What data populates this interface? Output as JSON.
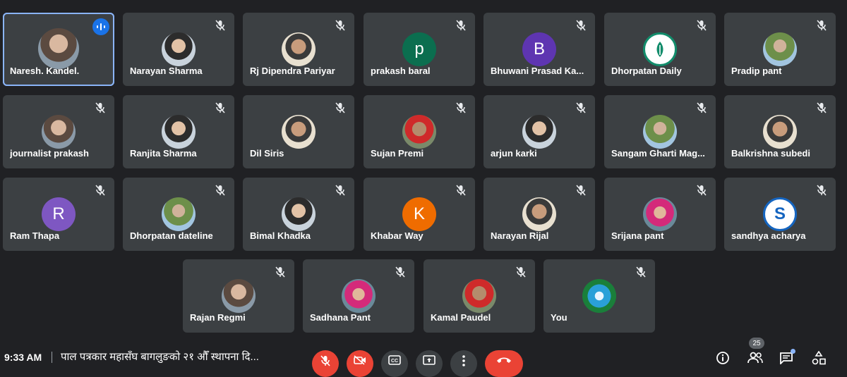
{
  "participants": [
    {
      "name": "Naresh. Kandel.",
      "avatar": "photo",
      "speaking": true
    },
    {
      "name": "Narayan Sharma",
      "avatar": "photo"
    },
    {
      "name": "Rj Dipendra Pariyar",
      "avatar": "photo"
    },
    {
      "name": "prakash baral",
      "avatar": "letter",
      "letter": "p",
      "color": "#0b6e4f"
    },
    {
      "name": "Bhuwani Prasad Ka...",
      "avatar": "letter",
      "letter": "B",
      "color": "#5e35b1"
    },
    {
      "name": "Dhorpatan Daily",
      "avatar": "logo"
    },
    {
      "name": "Pradip pant",
      "avatar": "photo"
    },
    {
      "name": "journalist prakash",
      "avatar": "photo"
    },
    {
      "name": "Ranjita Sharma",
      "avatar": "photo"
    },
    {
      "name": "Dil Siris",
      "avatar": "photo"
    },
    {
      "name": "Sujan Premi",
      "avatar": "photo"
    },
    {
      "name": "arjun karki",
      "avatar": "photo"
    },
    {
      "name": "Sangam Gharti Mag...",
      "avatar": "photo"
    },
    {
      "name": "Balkrishna subedi",
      "avatar": "photo"
    },
    {
      "name": "Ram Thapa",
      "avatar": "letter",
      "letter": "R",
      "color": "#7e57c2"
    },
    {
      "name": "Dhorpatan dateline",
      "avatar": "photo"
    },
    {
      "name": "Bimal Khadka",
      "avatar": "photo"
    },
    {
      "name": "Khabar Way",
      "avatar": "letter",
      "letter": "K",
      "color": "#ef6c00"
    },
    {
      "name": "Narayan Rijal",
      "avatar": "photo"
    },
    {
      "name": "Srijana pant",
      "avatar": "photo"
    },
    {
      "name": "sandhya acharya",
      "avatar": "letter-ring",
      "letter": "S",
      "color": "#1565c0"
    },
    {
      "name": "Rajan Regmi",
      "avatar": "photo"
    },
    {
      "name": "Sadhana Pant",
      "avatar": "photo"
    },
    {
      "name": "Kamal Paudel",
      "avatar": "photo"
    },
    {
      "name": "You",
      "avatar": "globe"
    }
  ],
  "bottom_bar": {
    "time": "9:33 AM",
    "meeting_title": "पाल पत्रकार महासँघ बागलुङको २१ औँ स्थापना दि...",
    "participant_count": "25"
  },
  "colors": {
    "background": "#202124",
    "tile": "#3c4043",
    "active_outline": "#8ab4f8",
    "hangup": "#ea4335",
    "speaking": "#1a73e8"
  },
  "icons": {
    "muted": "mic-off-icon",
    "speaking": "audio-level-icon",
    "controls": [
      "mic-off-icon",
      "camera-off-icon",
      "captions-icon",
      "present-icon",
      "more-options-icon",
      "hang-up-icon"
    ],
    "right": [
      "info-icon",
      "people-icon",
      "chat-icon",
      "activities-icon"
    ]
  }
}
